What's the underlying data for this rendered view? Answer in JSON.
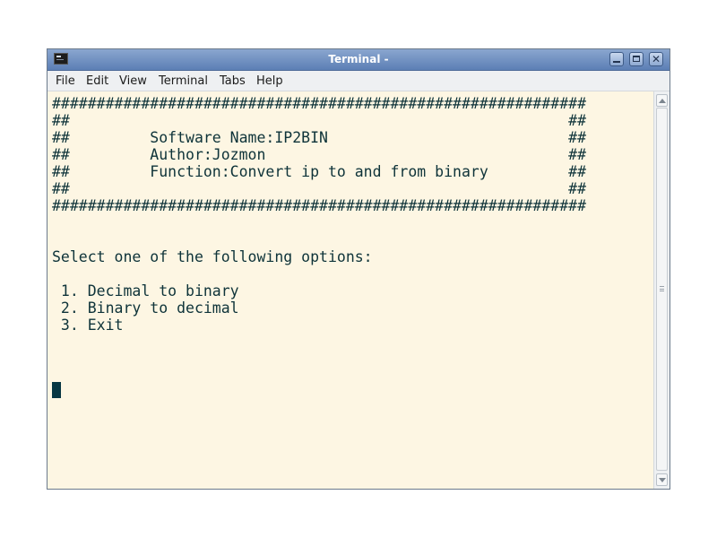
{
  "window": {
    "title": "Terminal -",
    "title_icon": "terminal-icon"
  },
  "controls": {
    "minimize": "minimize-icon",
    "maximize": "maximize-icon",
    "close_glyph": "✕"
  },
  "menu": {
    "file": "File",
    "edit": "Edit",
    "view": "View",
    "terminal": "Terminal",
    "tabs": "Tabs",
    "help": "Help"
  },
  "terminal": {
    "lines": [
      "############################################################",
      "##                                                        ##",
      "##         Software Name:IP2BIN                           ##",
      "##         Author:Jozmon                                  ##",
      "##         Function:Convert ip to and from binary         ##",
      "##                                                        ##",
      "############################################################",
      "",
      "",
      "Select one of the following options:",
      "",
      " 1. Decimal to binary",
      " 2. Binary to decimal",
      " 3. Exit"
    ]
  },
  "colors": {
    "background": "#fdf6e3",
    "foreground": "#0e3339",
    "cursor": "#073642",
    "titlebar": "#6f90c2"
  }
}
